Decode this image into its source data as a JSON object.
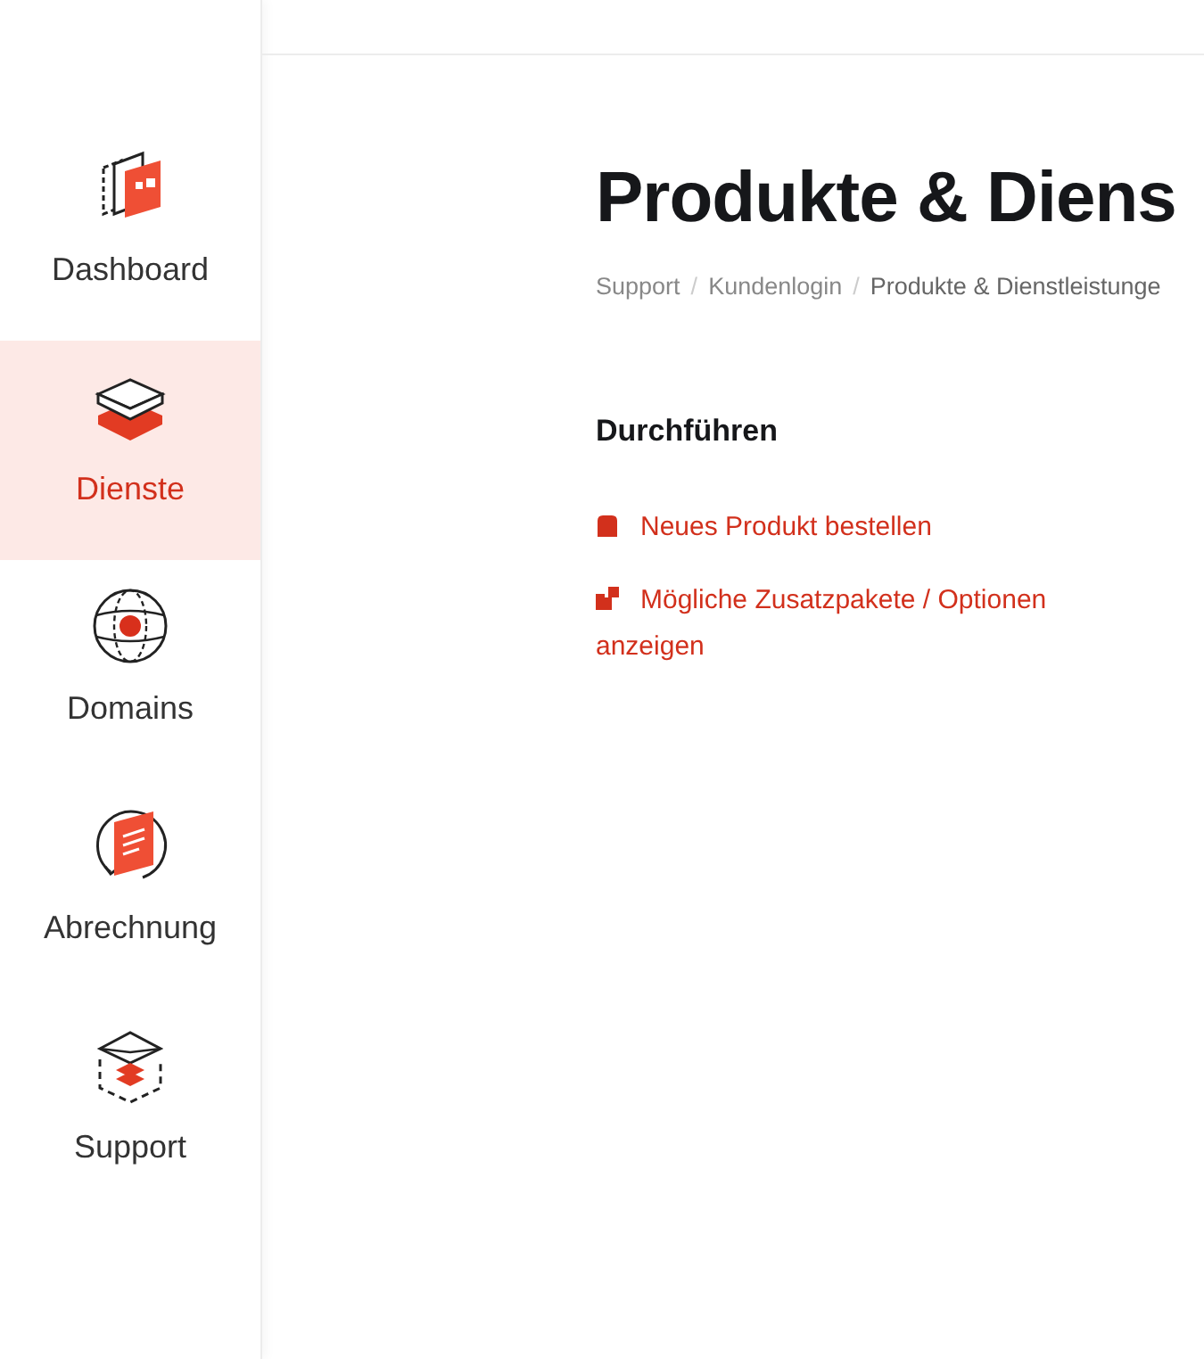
{
  "sidebar": {
    "items": [
      {
        "label": "Dashboard",
        "kind": "dashboard",
        "selected": false
      },
      {
        "label": "Dienste",
        "kind": "services",
        "selected": true
      },
      {
        "label": "Domains",
        "kind": "domains",
        "selected": false
      },
      {
        "label": "Abrechnung",
        "kind": "billing",
        "selected": false
      },
      {
        "label": "Support",
        "kind": "support",
        "selected": false
      }
    ]
  },
  "page": {
    "title": "Produkte & Diens",
    "breadcrumb": [
      "Support",
      "/",
      "Kundenlogin",
      "/",
      "Produkte & Dienstleistunge"
    ],
    "section_title": "Durchführen",
    "actions": [
      {
        "label": "Neues Produkt bestellen",
        "kind": "bag"
      },
      {
        "label": "Mögliche Zusatzpakete / Optionen anzeigen",
        "kind": "addons"
      }
    ]
  }
}
